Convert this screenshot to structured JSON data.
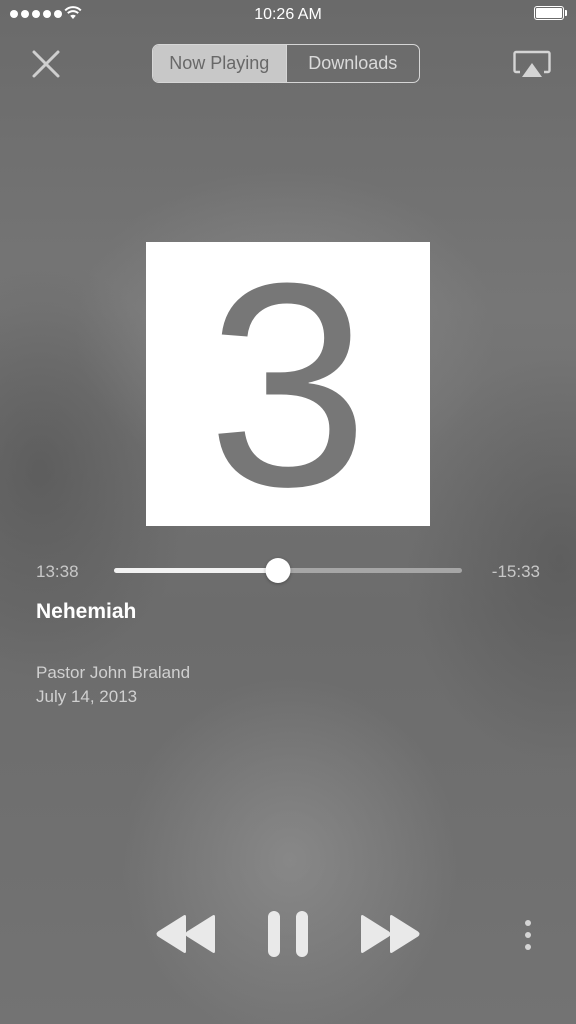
{
  "status_bar": {
    "time": "10:26 AM",
    "signal_bars": 5,
    "icons": [
      "signal-dots-icon",
      "wifi-icon",
      "battery-icon"
    ]
  },
  "header": {
    "close_icon": "close-icon",
    "tabs": [
      {
        "label": "Now Playing",
        "selected": true
      },
      {
        "label": "Downloads",
        "selected": false
      }
    ],
    "airplay_icon": "airplay-icon"
  },
  "artwork": {
    "number": "3",
    "background": "#ffffff",
    "number_color": "#777777"
  },
  "player": {
    "elapsed": "13:38",
    "remaining": "-15:33",
    "progress": 0.47,
    "title": "Nehemiah",
    "speaker": "Pastor John Braland",
    "date": "July 14, 2013"
  },
  "controls": {
    "icons": [
      "rewind-icon",
      "pause-icon",
      "fast-forward-icon",
      "more-icon"
    ]
  },
  "colors": {
    "background": "#6e6e6e",
    "accent": "#ffffff",
    "muted_text": "#c8c8c8"
  }
}
